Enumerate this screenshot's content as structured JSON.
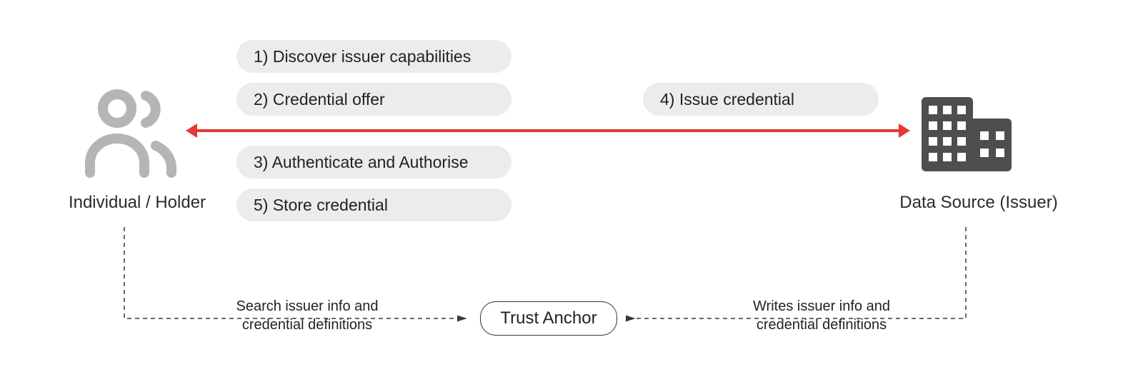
{
  "entities": {
    "holder_label": "Individual / Holder",
    "issuer_label": "Data Source (Issuer)"
  },
  "steps": {
    "s1": "1) Discover issuer capabilities",
    "s2": "2) Credential offer",
    "s3": "3) Authenticate and Authorise",
    "s4": "4) Issue credential",
    "s5": "5) Store credential"
  },
  "trust_anchor_label": "Trust Anchor",
  "connectors": {
    "left_label_line1": "Search issuer info and",
    "left_label_line2": "credential definitions",
    "right_label_line1": "Writes issuer info and",
    "right_label_line2": "credential definitions"
  },
  "colors": {
    "accent_red": "#e53935",
    "pill_bg": "#ececec",
    "stroke_dark": "#4a4a4a",
    "icon_grey": "#b5b5b5",
    "icon_dark": "#4e4e4e"
  }
}
